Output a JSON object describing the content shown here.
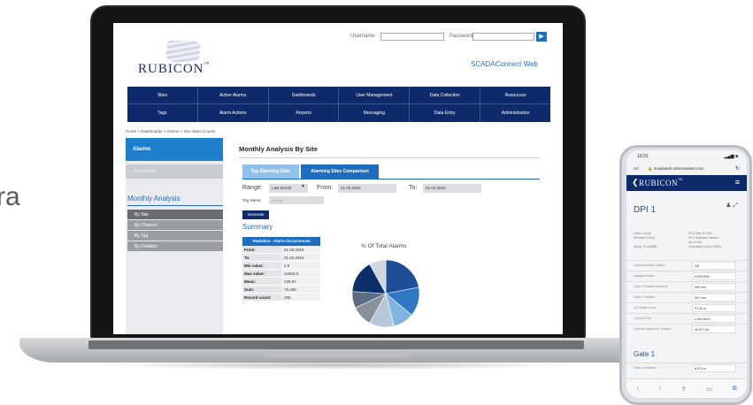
{
  "edge_text": "ra",
  "laptop": {
    "login": {
      "username_label": "Username",
      "password_label": "Password",
      "go": "▶"
    },
    "logo": "RUBICON",
    "logo_tm": "™",
    "scada_link": "SCADAConnect Web",
    "nav_row1": [
      "Sites",
      "Active Alarms",
      "Dashboards",
      "User Management",
      "Data Collection",
      "Resources"
    ],
    "nav_row2": [
      "Tags",
      "Alarm Actions",
      "Reports",
      "Messaging",
      "Data Entry",
      "Administration"
    ],
    "breadcrumb": "Home > Dashboards > Alarms > Site Alarm Counts",
    "sidebar": {
      "alarms": "Alarms",
      "dashboard": "Dashboard",
      "section": "Monthly Analysis",
      "items": [
        "By Site",
        "By Channel",
        "By Tag",
        "By Duration"
      ]
    },
    "main": {
      "title": "Monthly Analysis By Site",
      "tabs": [
        "Top Alarming Sites",
        "Alarming Sites Comparison"
      ],
      "range_label": "Range:",
      "range_value": "Last Month",
      "from_label": "From:",
      "from_value": "01.03.2016",
      "to_label": "To:",
      "to_value": "01.04.2016",
      "tag_label": "Tag Name:",
      "tag_placeholder": "All tags",
      "generate": "Generate",
      "summary": "Summary",
      "stats_header": "Statistics - Alarm Occurrences",
      "stats": [
        {
          "k": "From:",
          "v": "01.03.2016"
        },
        {
          "k": "To:",
          "v": "01.04.2016"
        },
        {
          "k": "Min value:",
          "v": "1.0"
        },
        {
          "k": "Max value:",
          "v": "14403.0"
        },
        {
          "k": "Mean:",
          "v": "236.97"
        },
        {
          "k": "Sum:",
          "v": "78,465"
        },
        {
          "k": "Record count:",
          "v": "295"
        }
      ],
      "pie_title": "% Of Total Alarms",
      "pie_colors": [
        "#1f4e96",
        "#2f78c4",
        "#7fb3e0",
        "#b7c7d8",
        "#8a9099",
        "#5a6b82",
        "#0c2f6b",
        "#cfd6df"
      ]
    }
  },
  "phone": {
    "time": "10:31",
    "signal": "▂▄▆ ■",
    "aa": "AA",
    "url": "🔒 scadaweb.rubiconwater.com",
    "reload": "↻",
    "back": "❮",
    "brand": "RUBICON",
    "brand_tm": "™",
    "menu": "≡",
    "page_title": "DPI 1",
    "page_icons": "♟ ⤢",
    "info_left": [
      "Gate 1 Local",
      "Remote:LOCAL",
      "",
      "Setup: N: AUMM"
    ],
    "info_right": [
      "RTU Site ID: 002",
      "RTU Software Version",
      "No: 6.003",
      "Operating Level:0.000m"
    ],
    "rows": [
      {
        "k": "Communication Status",
        "v": "OK"
      },
      {
        "k": "Irrigation Mode",
        "v": "POSITION"
      },
      {
        "k": "Gate 1 Position Setpoint",
        "v": "560 mm"
      },
      {
        "k": "Gate 1 Position",
        "v": "547 mm"
      },
      {
        "k": "U/S Water Level",
        "v": "9.124 m"
      },
      {
        "k": "Current Flow",
        "v": "0.500 ML/h"
      },
      {
        "k": "Current Volume for Season",
        "v": "45.671 ML"
      }
    ],
    "section": "Gate 1",
    "section_row": {
      "k": "Gate 1 Elevation",
      "v": "8.574 m"
    },
    "toolbar": [
      "‹",
      "›",
      "⇪",
      "▭",
      "⧉"
    ]
  }
}
